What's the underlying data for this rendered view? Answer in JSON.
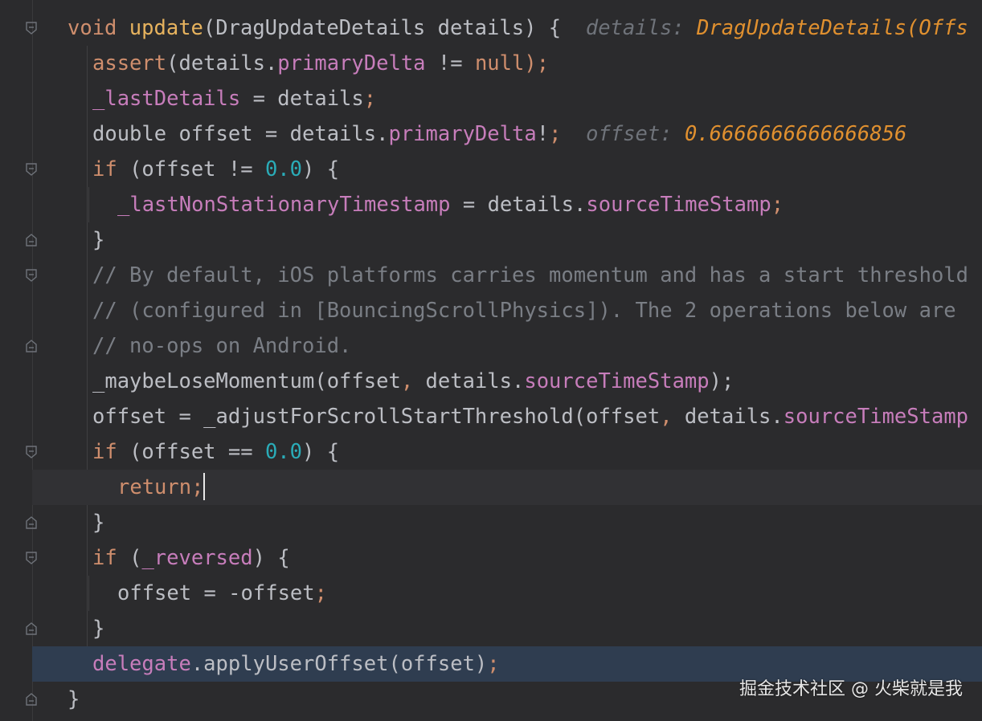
{
  "editor": {
    "lines": {
      "l0": {
        "kw": "void",
        "fn": "update",
        "rest": "(DragUpdateDetails details) {",
        "hint_label": "details:",
        "hint_value": "DragUpdateDetails(Offs"
      },
      "l1": {
        "fn": "assert",
        "a": "(details.",
        "prop": "primaryDelta",
        "b": " != ",
        "kw": "null",
        "c": ");"
      },
      "l2": {
        "prop": "_lastDetails",
        "a": " = details",
        "b": ";"
      },
      "l3": {
        "a": "double offset = details.",
        "prop": "primaryDelta",
        "b": "!",
        "c": ";",
        "hint_label": "offset:",
        "hint_value": "0.6666666666666856"
      },
      "l4": {
        "kw": "if",
        "a": " (offset != ",
        "num": "0.0",
        "b": ") {"
      },
      "l5": {
        "prop": "_lastNonStationaryTimestamp",
        "a": " = details.",
        "prop2": "sourceTimeStamp",
        "b": ";"
      },
      "l6": {
        "a": "}"
      },
      "l7": {
        "cmt": "// By default, iOS platforms carries momentum and has a start threshold"
      },
      "l8": {
        "cmt": "// (configured in [BouncingScrollPhysics]). The 2 operations below are"
      },
      "l9": {
        "cmt": "// no-ops on Android."
      },
      "l10": {
        "a": "_maybeLoseMomentum(offset",
        "b": ",",
        "c": " details.",
        "prop": "sourceTimeStamp",
        "d": ");"
      },
      "l11": {
        "a": "offset = _adjustForScrollStartThreshold(offset",
        "b": ",",
        "c": " details.",
        "prop": "sourceTimeStamp"
      },
      "l12": {
        "kw": "if",
        "a": " (offset == ",
        "num": "0.0",
        "b": ") {"
      },
      "l13": {
        "kw": "return",
        "b": ";"
      },
      "l14": {
        "a": "}"
      },
      "l15": {
        "kw": "if",
        "a": " (",
        "prop": "_reversed",
        "b": ") {"
      },
      "l16": {
        "a": "offset = -offset",
        "b": ";"
      },
      "l17": {
        "a": "}"
      },
      "l18": {
        "prop": "delegate",
        "a": ".applyUserOffset(offset)",
        "b": ";"
      },
      "l19": {
        "a": "}"
      }
    }
  },
  "watermark": "掘金技术社区 @ 火柴就是我"
}
